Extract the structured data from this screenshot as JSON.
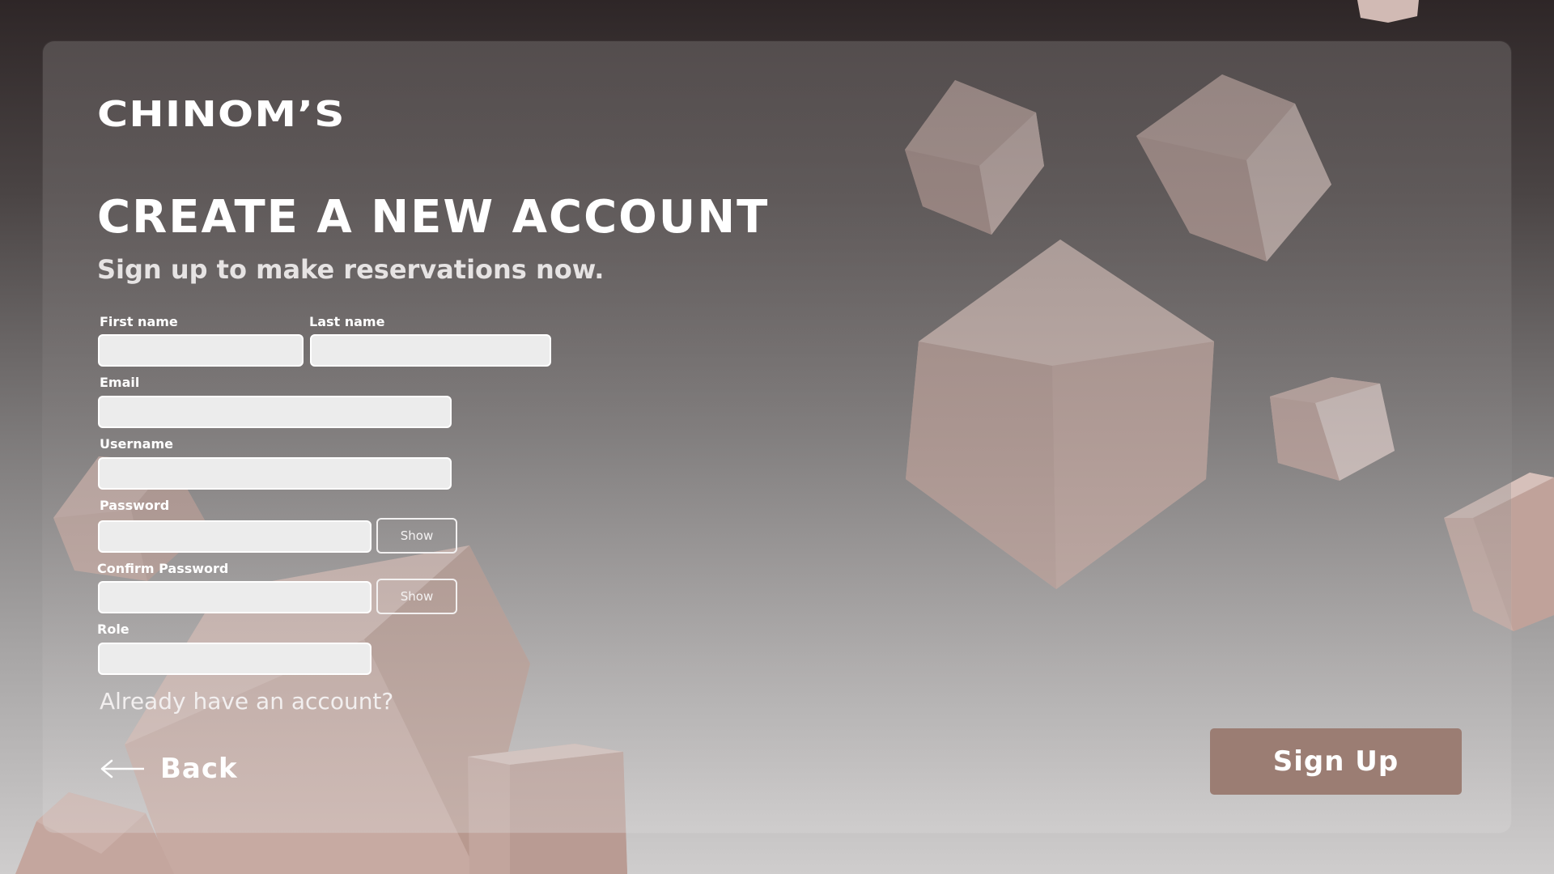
{
  "brand": {
    "logo": "CHINOM’S"
  },
  "page": {
    "title": "CREATE A NEW ACCOUNT",
    "subtitle": "Sign up to make reservations now."
  },
  "form": {
    "first_name_label": "First name",
    "last_name_label": "Last name",
    "email_label": "Email",
    "username_label": "Username",
    "password_label": "Password",
    "confirm_password_label": "Confirm Password",
    "role_label": "Role",
    "first_name_value": "",
    "last_name_value": "",
    "email_value": "",
    "username_value": "",
    "password_value": "",
    "confirm_password_value": "",
    "role_value": "",
    "show_label": "Show",
    "show_confirm_label": "Show"
  },
  "footer": {
    "already_text": "Already have an account?",
    "back_label": "Back",
    "signup_label": "Sign Up"
  },
  "colors": {
    "accent": "#9b7d73",
    "cube": "#c9aba3"
  },
  "icons": {
    "back": "arrow-left-icon"
  }
}
